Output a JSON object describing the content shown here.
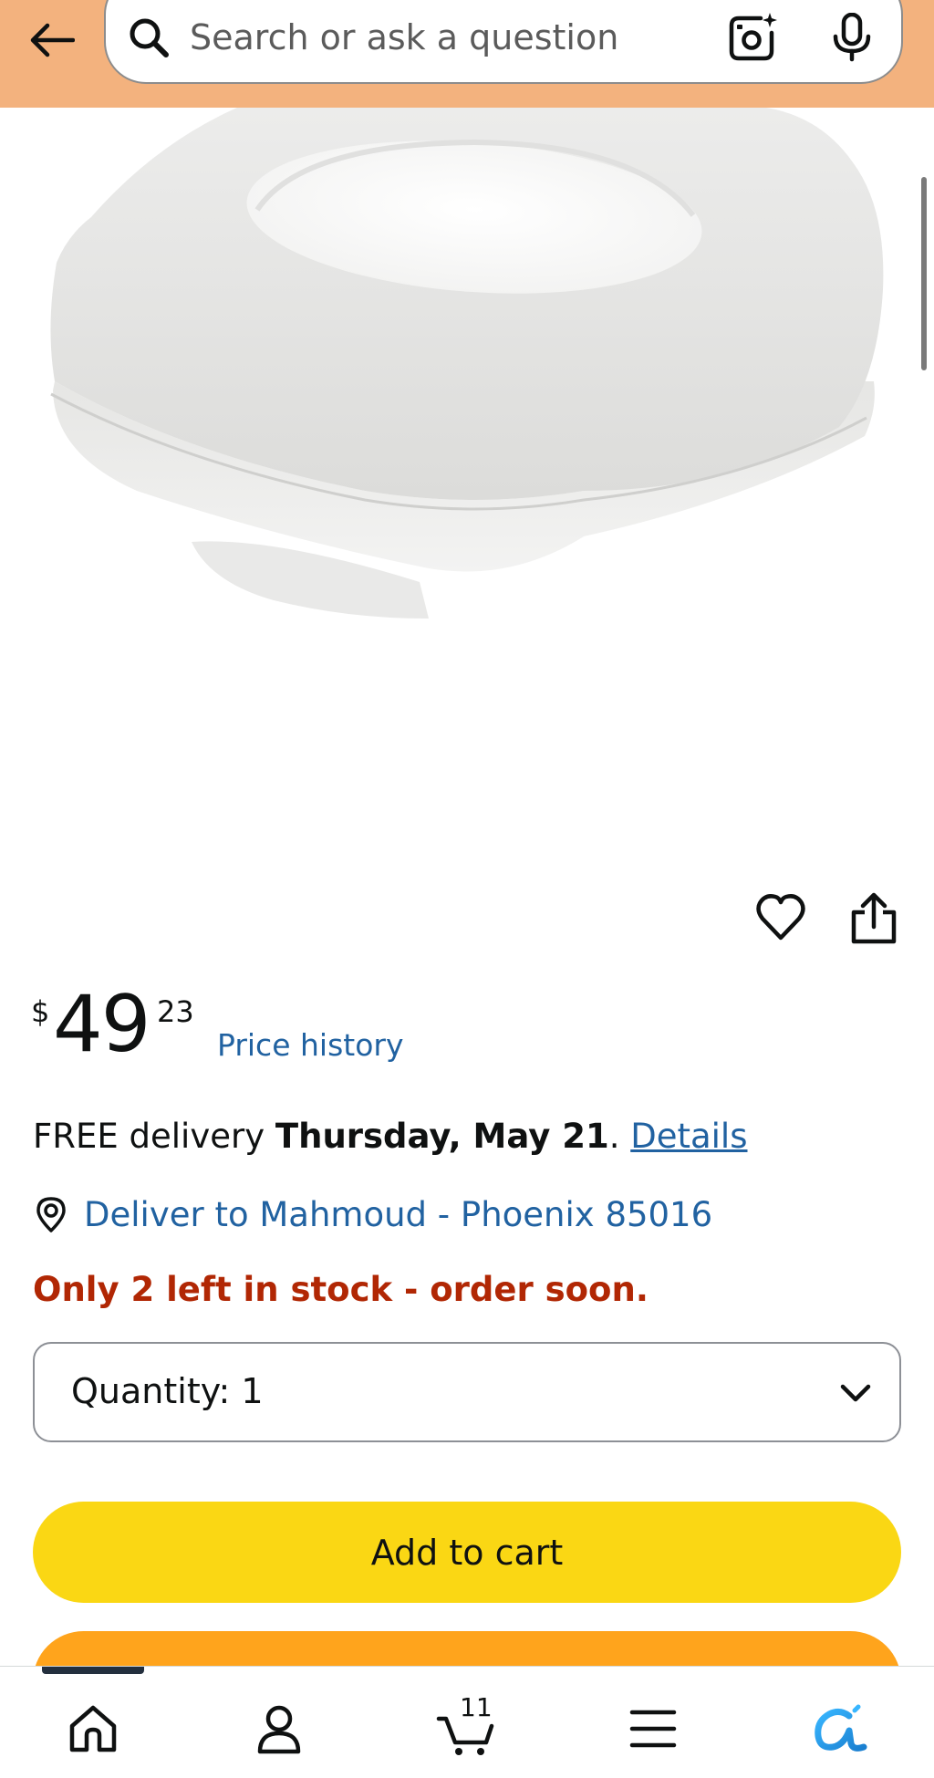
{
  "header": {
    "search": {
      "placeholder": "Search or ask a question"
    }
  },
  "price": {
    "symbol": "$",
    "whole": "49",
    "fraction": "23",
    "history_label": "Price history"
  },
  "delivery": {
    "prefix": "FREE delivery ",
    "date": "Thursday, May 21",
    "separator": ". ",
    "details_label": "Details"
  },
  "location": {
    "label": "Deliver to Mahmoud - Phoenix 85016"
  },
  "stock": {
    "message": "Only 2 left in stock - order soon."
  },
  "quantity": {
    "label": "Quantity:",
    "value": "1"
  },
  "buttons": {
    "add_to_cart": "Add to cart"
  },
  "bottom_nav": {
    "cart_count": "11",
    "items": [
      "home-icon",
      "account-icon",
      "cart-icon",
      "menu-icon",
      "rufus-icon"
    ]
  },
  "colors": {
    "header_bg": "#f3b27e",
    "link": "#2162a1",
    "stock_alert": "#b12704",
    "add_to_cart": "#fad714",
    "buy_now": "#ffa41c",
    "rufus_accent": "#1fa3e0"
  }
}
